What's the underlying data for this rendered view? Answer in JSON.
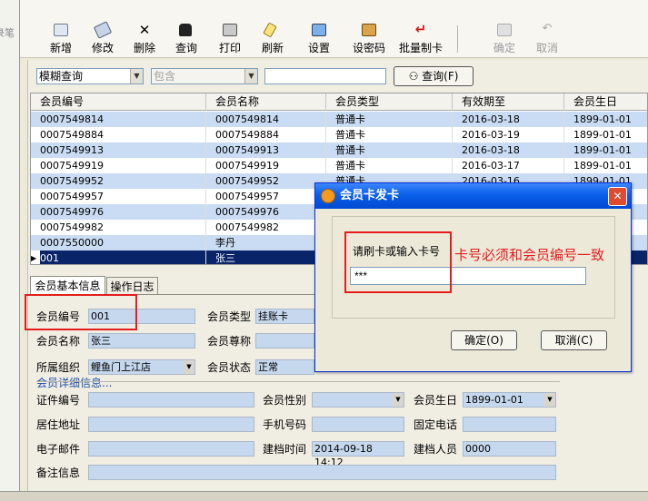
{
  "left_strip": {
    "label": "录笔"
  },
  "toolbar": {
    "items": [
      {
        "label": "新增",
        "enabled": true
      },
      {
        "label": "修改",
        "enabled": true
      },
      {
        "label": "删除",
        "enabled": true
      },
      {
        "label": "查询",
        "enabled": true
      },
      {
        "label": "打印",
        "enabled": true
      },
      {
        "label": "刷新",
        "enabled": true
      },
      {
        "label": "设置",
        "enabled": true
      },
      {
        "label": "设密码",
        "enabled": true
      },
      {
        "label": "批量制卡",
        "enabled": true
      },
      {
        "label": "确定",
        "enabled": false
      },
      {
        "label": "取消",
        "enabled": false
      }
    ]
  },
  "filter": {
    "mode": "模糊查询",
    "condition": "包含",
    "keyword": "",
    "search_label": "查询(F)"
  },
  "grid": {
    "columns": [
      "会员编号",
      "会员名称",
      "会员类型",
      "有效期至",
      "会员生日"
    ],
    "rows": [
      [
        "0007549814",
        "0007549814",
        "普通卡",
        "2016-03-18",
        "1899-01-01"
      ],
      [
        "0007549884",
        "0007549884",
        "普通卡",
        "2016-03-19",
        "1899-01-01"
      ],
      [
        "0007549913",
        "0007549913",
        "普通卡",
        "2016-03-18",
        "1899-01-01"
      ],
      [
        "0007549919",
        "0007549919",
        "普通卡",
        "2016-03-17",
        "1899-01-01"
      ],
      [
        "0007549952",
        "0007549952",
        "普通卡",
        "2016-03-16",
        "1899-01-01"
      ],
      [
        "0007549957",
        "0007549957",
        "",
        "",
        ""
      ],
      [
        "0007549976",
        "0007549976",
        "",
        "",
        ""
      ],
      [
        "0007549982",
        "0007549982",
        "",
        "",
        ""
      ],
      [
        "0007550000",
        "李丹",
        "",
        "",
        ""
      ],
      [
        "001",
        "张三",
        "",
        "",
        ""
      ]
    ],
    "selected_index": 9
  },
  "tabs": [
    "会员基本信息",
    "操作日志"
  ],
  "form": {
    "member_no_label": "会员编号",
    "member_no": "001",
    "member_type_label": "会员类型",
    "member_type": "挂账卡",
    "member_name_label": "会员名称",
    "member_name": "张三",
    "member_title_label": "会员尊称",
    "member_title": "",
    "org_label": "所属组织",
    "org": "鲤鱼门上江店",
    "status_label": "会员状态",
    "status": "正常",
    "detail_section": "会员详细信息...",
    "id_no_label": "证件编号",
    "id_no": "",
    "gender_label": "会员性别",
    "gender": "",
    "birthday_label": "会员生日",
    "birthday": "1899-01-01",
    "address_label": "居住地址",
    "address": "",
    "mobile_label": "手机号码",
    "mobile": "",
    "phone_label": "固定电话",
    "phone": "",
    "email_label": "电子邮件",
    "email": "",
    "created_label": "建档时间",
    "created": "2014-09-18 14:12",
    "creator_label": "建档人员",
    "creator": "0000",
    "remark_label": "备注信息",
    "remark": ""
  },
  "dialog": {
    "title": "会员卡发卡",
    "prompt": "请刷卡或输入卡号",
    "card_value": "***",
    "ok_label": "确定(O)",
    "cancel_label": "取消(C)"
  },
  "annotation": {
    "text": "卡号必须和会员编号一致",
    "color": "#e41d1d"
  }
}
